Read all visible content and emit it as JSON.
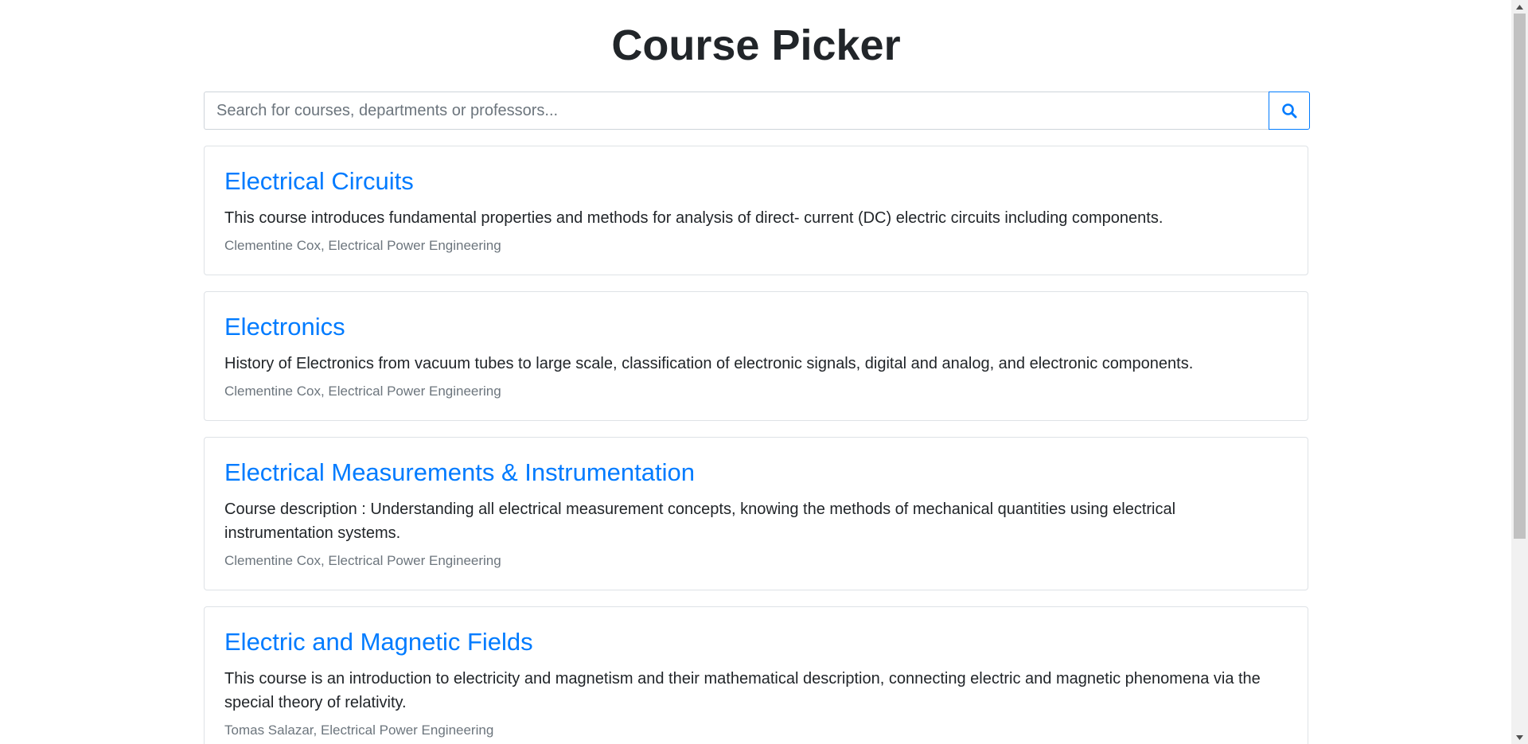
{
  "header": {
    "title": "Course Picker"
  },
  "search": {
    "placeholder": "Search for courses, departments or professors...",
    "value": "",
    "button_icon": "search-icon"
  },
  "courses": [
    {
      "title": "Electrical Circuits",
      "description": "This course introduces fundamental properties and methods for analysis of direct- current (DC) electric circuits including components.",
      "meta": "Clementine Cox, Electrical Power Engineering"
    },
    {
      "title": "Electronics",
      "description": "History of Electronics from vacuum tubes to large scale, classification of electronic signals, digital and analog, and electronic components.",
      "meta": "Clementine Cox, Electrical Power Engineering"
    },
    {
      "title": "Electrical Measurements & Instrumentation",
      "description": "Course description : Understanding all electrical measurement concepts, knowing the methods of mechanical quantities using electrical instrumentation systems.",
      "meta": "Clementine Cox, Electrical Power Engineering"
    },
    {
      "title": "Electric and Magnetic Fields",
      "description": "This course is an introduction to electricity and magnetism and their mathematical description, connecting electric and magnetic phenomena via the special theory of relativity.",
      "meta": "Tomas Salazar, Electrical Power Engineering"
    }
  ],
  "colors": {
    "accent": "#007bff",
    "text": "#212529",
    "muted": "#6c757d",
    "border": "#dee2e6"
  }
}
